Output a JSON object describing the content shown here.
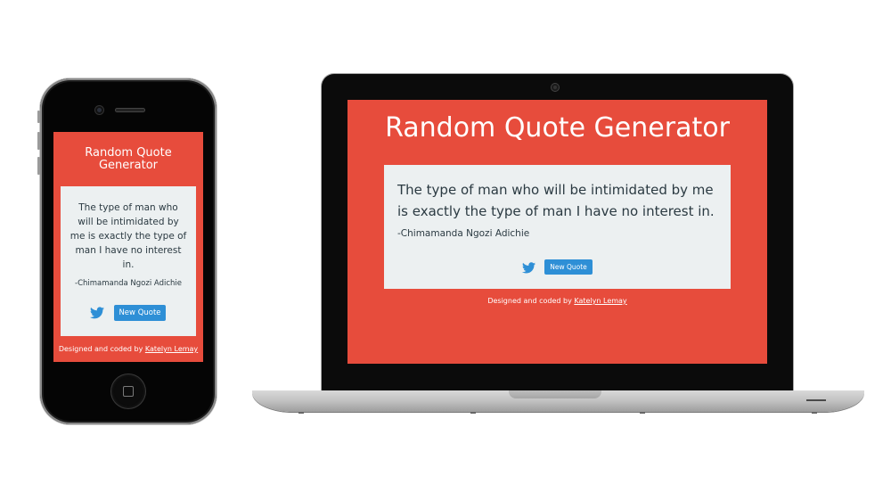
{
  "app": {
    "title": "Random Quote Generator",
    "quote_text": "The type of man who will be intimidated by me is exactly the type of man I have no interest in.",
    "author": "-Chimamanda Ngozi Adichie",
    "new_quote_label": "New Quote",
    "footer_prefix": "Designed and coded by",
    "footer_link": "Katelyn Lemay",
    "colors": {
      "background": "#e74c3c",
      "card": "#ecf0f1",
      "button": "#2e8fd6",
      "text": "#2b3a42"
    },
    "icons": {
      "share": "twitter-icon"
    }
  }
}
